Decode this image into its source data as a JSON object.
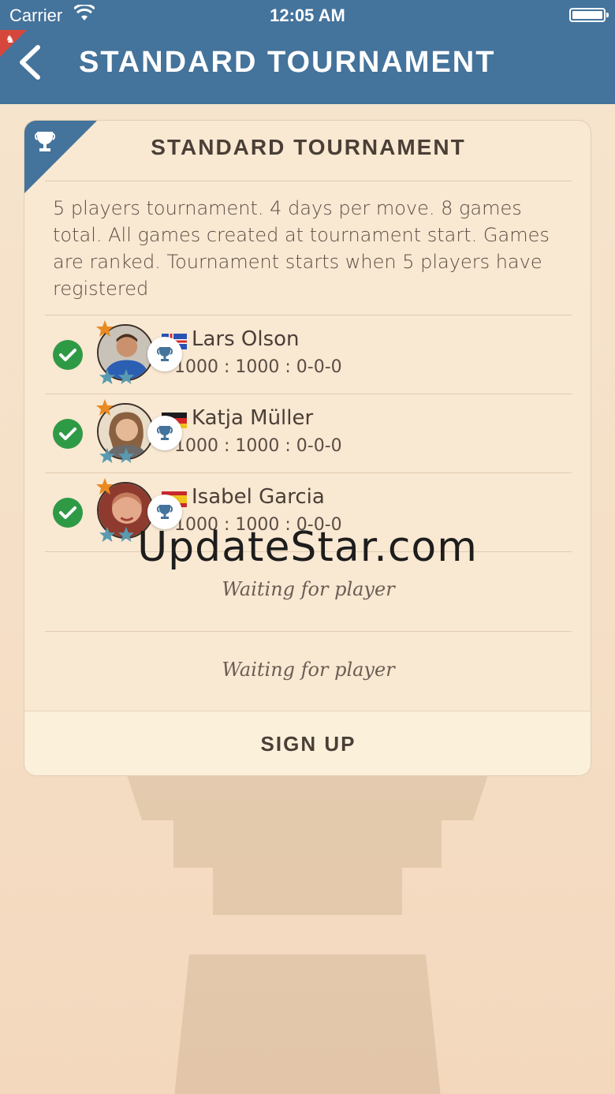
{
  "status_bar": {
    "carrier": "Carrier",
    "time": "12:05 AM"
  },
  "header": {
    "title": "STANDARD TOURNAMENT",
    "notification_badge": "♞"
  },
  "card": {
    "title": "STANDARD TOURNAMENT",
    "description": "5 players tournament. 4 days per move. 8 games total. All games created at tournament start. Games are ranked. Tournament starts when 5 players have registered",
    "players": [
      {
        "name": "Lars Olson",
        "rating": "1000 : 1000 : 0-0-0",
        "country": "iceland-flag"
      },
      {
        "name": "Katja Müller",
        "rating": "1000 : 1000 : 0-0-0",
        "country": "germany-flag"
      },
      {
        "name": "Isabel Garcia",
        "rating": "1000 : 1000 : 0-0-0",
        "country": "spain-flag"
      }
    ],
    "waiting_slots": [
      "Waiting for player",
      "Waiting for player"
    ],
    "signup_label": "SIGN UP"
  },
  "watermark": "UpdateStar.com",
  "colors": {
    "header_bg": "#44739b",
    "card_bg": "#f9e8d2",
    "check_green": "#2f9a45",
    "star_orange": "#e98a22",
    "star_blue": "#5a9ab0"
  }
}
